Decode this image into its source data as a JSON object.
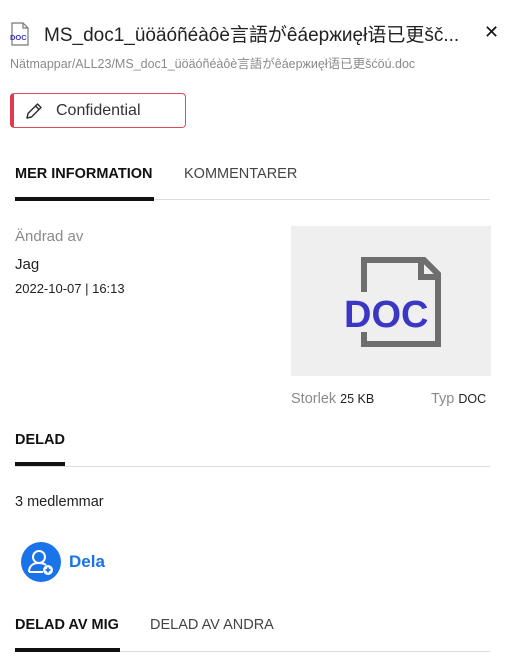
{
  "header": {
    "file_icon_text": "DOC",
    "title": "MS_doc1_üöäóñéàôè言語がêáержиęł语已更šč...",
    "path": "Nätmappar/ALL23/MS_doc1_üöäóñéàôè言語がêáержиęł语已更šćöú.doc",
    "close_glyph": "✕"
  },
  "classification": {
    "label": "Confidential",
    "accent_color": "#e03a4e"
  },
  "tabs": [
    {
      "label": "MER INFORMATION",
      "active": true
    },
    {
      "label": "KOMMENTARER",
      "active": false
    }
  ],
  "details": {
    "modified_by_label": "Ändrad av",
    "modified_by_value": "Jag",
    "modified_date": "2022-10-07 | 16:13",
    "thumbnail_text": "DOC",
    "size_label": "Storlek",
    "size_value": "25 KB",
    "type_label": "Typ",
    "type_value": "DOC"
  },
  "shared": {
    "heading": "DELAD",
    "members": "3 medlemmar",
    "share_label": "Dela"
  },
  "share_tabs": [
    {
      "label": "DELAD AV MIG",
      "active": true
    },
    {
      "label": "DELAD AV ANDRA",
      "active": false
    }
  ],
  "colors": {
    "accent_blue": "#1a73e8",
    "doc_purple": "#3b37c4"
  }
}
